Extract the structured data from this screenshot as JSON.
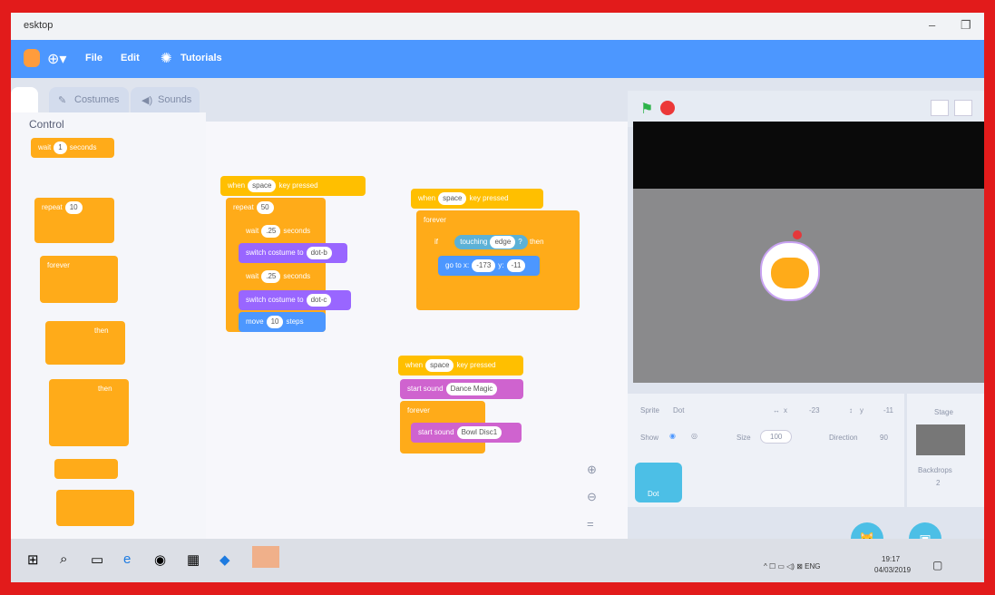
{
  "window": {
    "title": "esktop"
  },
  "menu": {
    "file": "File",
    "edit": "Edit",
    "tutorials": "Tutorials"
  },
  "tabs": {
    "costumes": "Costumes",
    "sounds": "Sounds"
  },
  "palette": {
    "category": "Control",
    "wait_label": "wait",
    "wait_value": "1",
    "wait_unit": "seconds",
    "repeat_label": "repeat",
    "repeat_value": "10",
    "forever_label": "forever",
    "if_then": "then"
  },
  "scripts": {
    "s1": {
      "hat": "when",
      "key": "space",
      "hat_tail": "key pressed",
      "repeat": "repeat",
      "repeat_n": "50",
      "wait": "wait",
      "wait_n": ".25",
      "wait_unit": "seconds",
      "switch1": "switch costume to",
      "costume1": "dot-b",
      "wait2_n": ".25",
      "switch2": "switch costume to",
      "costume2": "dot-c",
      "move": "move",
      "move_n": "10",
      "steps": "steps"
    },
    "s2": {
      "hat": "when",
      "key": "space",
      "hat_tail": "key pressed",
      "forever": "forever",
      "if": "if",
      "touching": "touching",
      "edge": "edge",
      "q": "?",
      "then": "then",
      "goto": "go to x:",
      "x": "-173",
      "y_label": "y:",
      "y": "-11"
    },
    "s3": {
      "hat": "when",
      "key": "space",
      "hat_tail": "key pressed",
      "start1": "start sound",
      "sound1": "Dance Magic",
      "forever": "forever",
      "start2": "start sound",
      "sound2": "Bowl Disc1"
    }
  },
  "sprite_panel": {
    "sprite_label": "Sprite",
    "sprite_name": "Dot",
    "x_label": "x",
    "x_value": "-23",
    "y_label": "y",
    "y_value": "-11",
    "show_label": "Show",
    "size_label": "Size",
    "size_value": "100",
    "direction_label": "Direction",
    "direction_value": "90",
    "thumb_name": "Dot"
  },
  "stage_panel": {
    "title": "Stage",
    "backdrops_label": "Backdrops",
    "backdrops_count": "2"
  },
  "taskbar": {
    "lang": "ENG",
    "time": "19:17",
    "date": "04/03/2019"
  },
  "colors": {
    "blue": "#4c97ff",
    "control": "#ffab19",
    "looks": "#9966ff",
    "sound": "#cf63cf",
    "frame": "#e21b1b"
  }
}
